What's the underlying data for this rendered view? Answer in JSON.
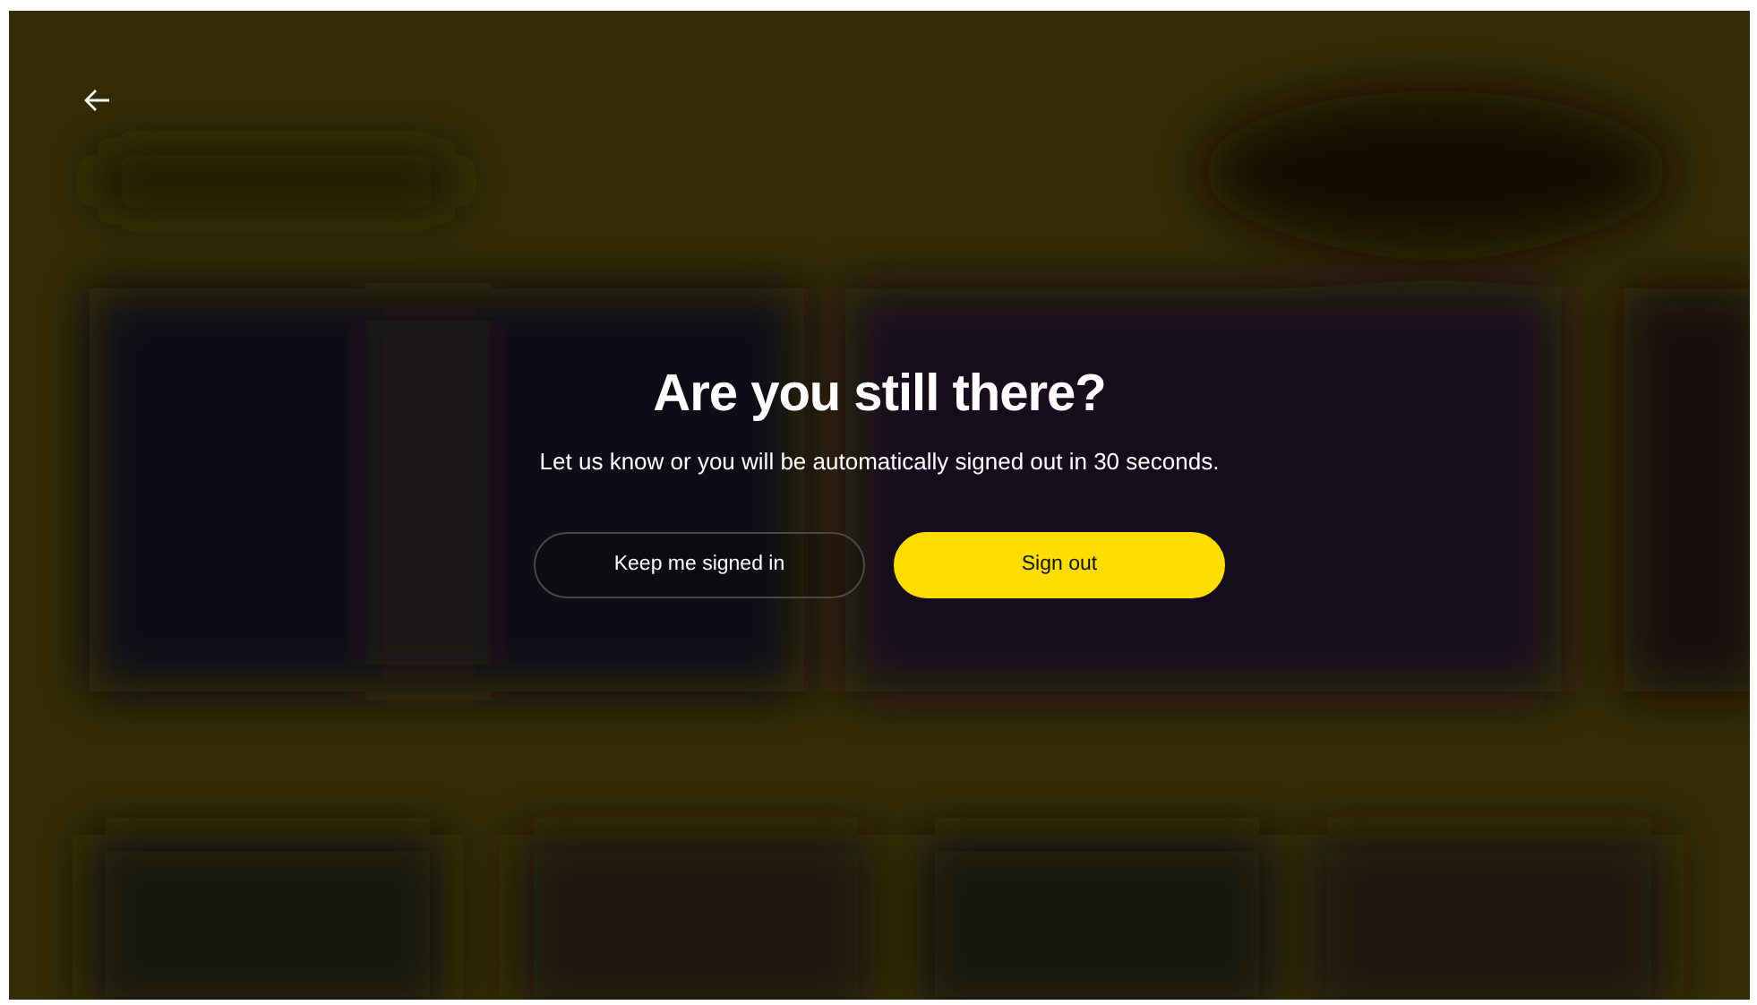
{
  "dialog": {
    "title": "Are you still there?",
    "message": "Let us know or you will be automatically signed out in 30 seconds.",
    "buttons": [
      {
        "label": "Keep me signed in",
        "kind": "secondary"
      },
      {
        "label": "Sign out",
        "kind": "primary"
      }
    ]
  }
}
